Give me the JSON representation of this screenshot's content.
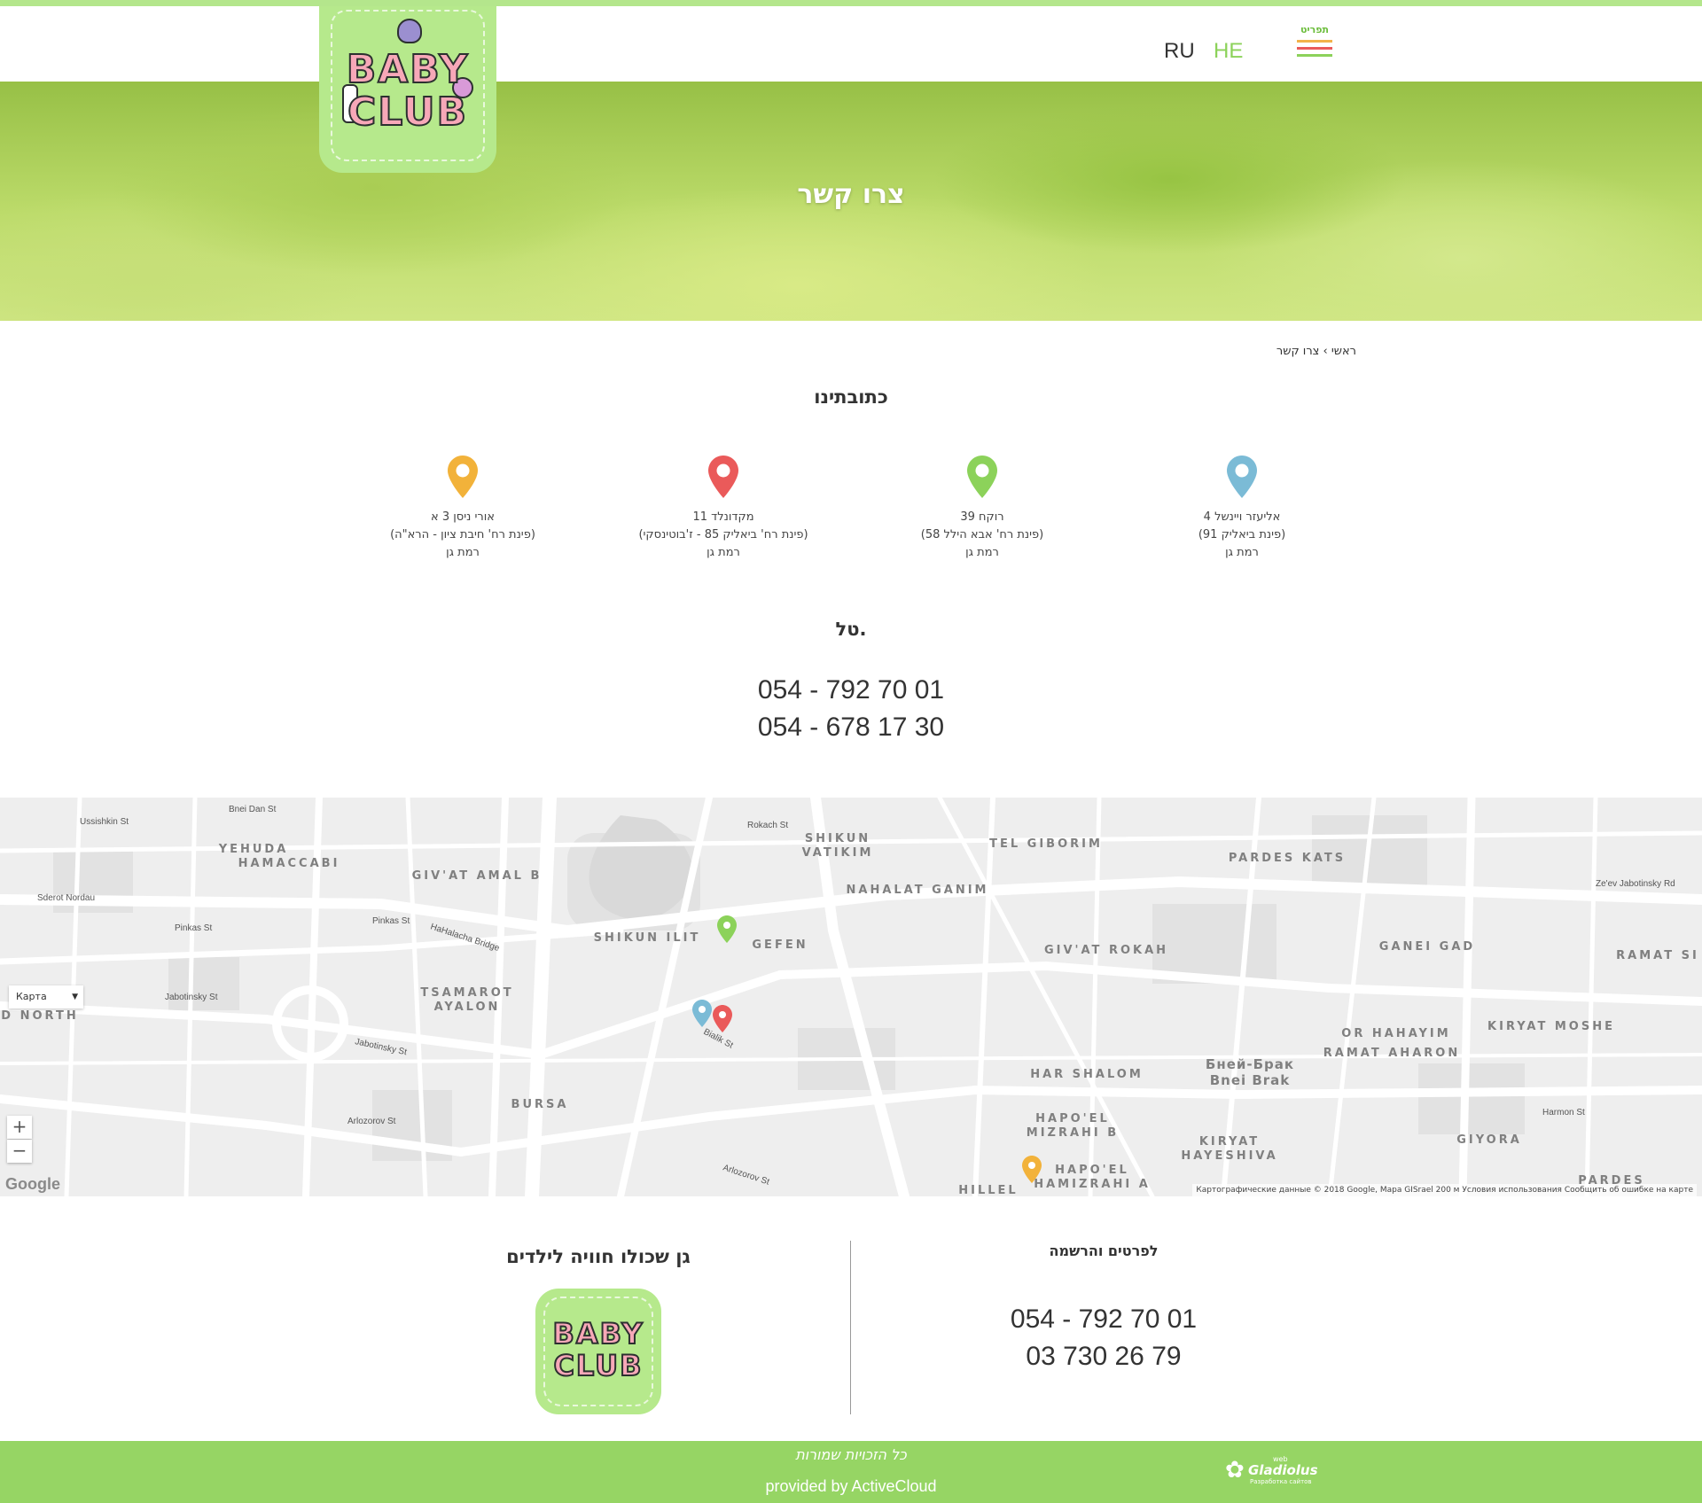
{
  "header": {
    "lang_ru": "RU",
    "lang_he": "HE",
    "menu_label": "תפריט",
    "menu_colors": [
      "#f2b24a",
      "#ea5a5a",
      "#8cd25a"
    ]
  },
  "logo": {
    "line1": "BABY",
    "line2": "CLUB"
  },
  "hero": {
    "title": "צרו קשר"
  },
  "breadcrumb": "ראשי › צרו קשר",
  "addresses": {
    "title": "כתובתינו",
    "items": [
      {
        "street": "אליעזר ויינשל 4",
        "note": "(פינת ביאליק 91)",
        "city": "רמת גן",
        "pin_color": "#7bbbd6"
      },
      {
        "street": "רוקח 39",
        "note": "(פינת רח' אבא הילל 58)",
        "city": "רמת גן",
        "pin_color": "#8cd25a"
      },
      {
        "street": "מקדונלד 11",
        "note": "(פינת רח' ביאליק 85 - ז'בוטינסקי)",
        "city": "רמת גן",
        "pin_color": "#ea5a5a"
      },
      {
        "street": "אורי ניסן 3 א",
        "note": "(פינת רח' חיבת ציון - הרא\"ה)",
        "city": "רמת גן",
        "pin_color": "#f2b23a"
      }
    ]
  },
  "tel": {
    "title": "טל.",
    "phones": [
      "054 - 792 70 01",
      "054 - 678 17 30"
    ]
  },
  "map": {
    "type_label": "Карта",
    "zoom_in": "+",
    "zoom_out": "−",
    "google": "Google",
    "attribution": "Картографические данные © 2018 Google, Mapa GISrael    200 м            Условия использования    Сообщить об ошибке на карте",
    "labels": [
      {
        "text": "YEHUDA",
        "cls": "big"
      },
      {
        "text": "HAMACCABI",
        "cls": "big"
      },
      {
        "text": "GIV'AT AMAL B",
        "cls": "big"
      },
      {
        "text": "SHIKUN",
        "cls": "big"
      },
      {
        "text": "VATIKIM",
        "cls": "big"
      },
      {
        "text": "TEL GIBORIM",
        "cls": "big"
      },
      {
        "text": "PARDES KATS",
        "cls": "big"
      },
      {
        "text": "NAHALAT GANIM",
        "cls": "big"
      },
      {
        "text": "SHIKUN ILIT",
        "cls": "big"
      },
      {
        "text": "GEFEN",
        "cls": "big"
      },
      {
        "text": "GIV'AT ROKAH",
        "cls": "big"
      },
      {
        "text": "GANEI GAD",
        "cls": "big"
      },
      {
        "text": "RAMAT SI",
        "cls": "big"
      },
      {
        "text": "TSAMAROT",
        "cls": "big"
      },
      {
        "text": "AYALON",
        "cls": "big"
      },
      {
        "text": "D NORTH",
        "cls": "big"
      },
      {
        "text": "OR HAHAYIM",
        "cls": "big"
      },
      {
        "text": "KIRYAT MOSHE",
        "cls": "big"
      },
      {
        "text": "RAMAT AHARON",
        "cls": "big"
      },
      {
        "text": "HAR SHALOM",
        "cls": "big"
      },
      {
        "text": "Бней-Брак",
        "cls": "big2"
      },
      {
        "text": "Bnei Brak",
        "cls": "big2"
      },
      {
        "text": "BURSA",
        "cls": "big"
      },
      {
        "text": "HAPO'EL",
        "cls": "big"
      },
      {
        "text": "MIZRAHI B",
        "cls": "big"
      },
      {
        "text": "KIRYAT",
        "cls": "big"
      },
      {
        "text": "HAYESHIVA",
        "cls": "big"
      },
      {
        "text": "GIYORA",
        "cls": "big"
      },
      {
        "text": "HAPO'EL",
        "cls": "big"
      },
      {
        "text": "HAMIZRAHI A",
        "cls": "big"
      },
      {
        "text": "HILLEL",
        "cls": "big"
      },
      {
        "text": "PARDES",
        "cls": "big"
      },
      {
        "text": "Ussishkin St",
        "cls": "st"
      },
      {
        "text": "Bnei Dan St",
        "cls": "st"
      },
      {
        "text": "Sderot Nordau",
        "cls": "st"
      },
      {
        "text": "Pinkas St",
        "cls": "st"
      },
      {
        "text": "Pinkas St",
        "cls": "st"
      },
      {
        "text": "HaHalacha Bridge",
        "cls": "st"
      },
      {
        "text": "Jabotinsky St",
        "cls": "st"
      },
      {
        "text": "Jabotinsky St",
        "cls": "st"
      },
      {
        "text": "Arlozorov St",
        "cls": "st"
      },
      {
        "text": "Arlozorov St",
        "cls": "st"
      },
      {
        "text": "Rokach St",
        "cls": "st"
      },
      {
        "text": "Ze'ev Jabotinsky Rd",
        "cls": "st"
      },
      {
        "text": "Bialik St",
        "cls": "st"
      },
      {
        "text": "Harmon St",
        "cls": "st"
      }
    ]
  },
  "footer": {
    "reg_title": "לפרטים והרשמה",
    "phones": [
      "054 - 792 70 01",
      "03 730 26 79"
    ],
    "tagline": "גן שכולו חוויה לילדים",
    "rights": "כל הזכויות שמורות",
    "provided": "provided by ActiveCloud",
    "dev_name": "Gladiolus",
    "dev_web": "web",
    "dev_sub": "Разработка сайтов"
  }
}
